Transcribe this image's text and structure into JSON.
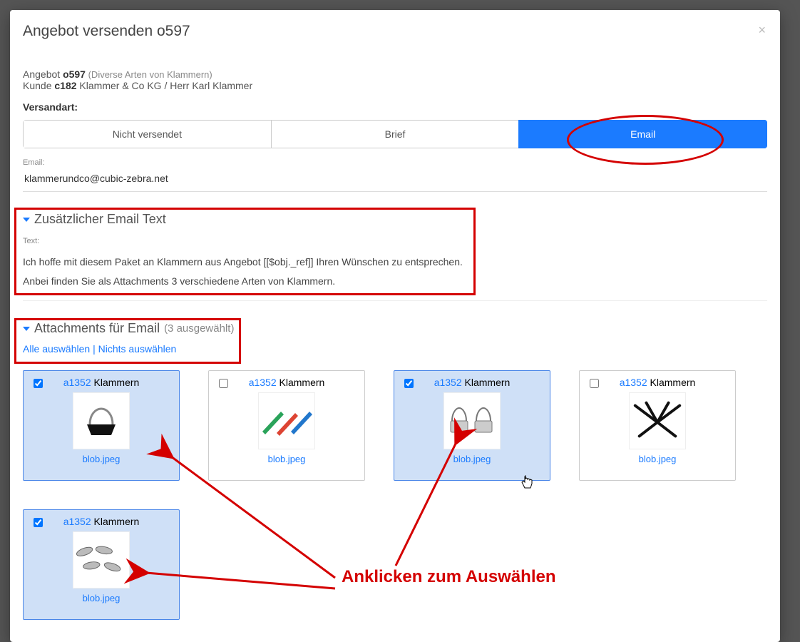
{
  "modal": {
    "title": "Angebot versenden o597",
    "info_line1_prefix": "Angebot ",
    "info_line1_bold": "o597",
    "info_line1_grey": " (Diverse Arten von Klammern)",
    "info_line2_prefix": "Kunde ",
    "info_line2_bold": "c182",
    "info_line2_rest": " Klammer & Co KG / Herr Karl Klammer",
    "versandart_label": "Versandart:",
    "seg": {
      "not_sent": "Nicht versendet",
      "letter": "Brief",
      "email": "Email"
    },
    "email_label": "Email:",
    "email_value": "klammerundco@cubic-zebra.net"
  },
  "extra_text": {
    "heading": "Zusätzlicher Email Text",
    "label": "Text:",
    "line1": "Ich hoffe mit diesem Paket an Klammern aus Angebot [[$obj._ref]] Ihren Wünschen zu entsprechen.",
    "line2": "Anbei finden Sie als Attachments 3 verschiedene Arten von Klammern."
  },
  "attachments": {
    "heading_prefix": "Attachments für Email ",
    "heading_count": "(3 ausgewählt)",
    "select_all": "Alle auswählen",
    "deselect_all": "Nichts auswählen",
    "items": [
      {
        "ref": "a1352",
        "name": "Klammern",
        "file": "blob.jpeg",
        "selected": true
      },
      {
        "ref": "a1352",
        "name": "Klammern",
        "file": "blob.jpeg",
        "selected": false
      },
      {
        "ref": "a1352",
        "name": "Klammern",
        "file": "blob.jpeg",
        "selected": true
      },
      {
        "ref": "a1352",
        "name": "Klammern",
        "file": "blob.jpeg",
        "selected": false
      },
      {
        "ref": "a1352",
        "name": "Klammern",
        "file": "blob.jpeg",
        "selected": true
      }
    ]
  },
  "annotation": {
    "callout": "Anklicken zum Auswählen"
  }
}
